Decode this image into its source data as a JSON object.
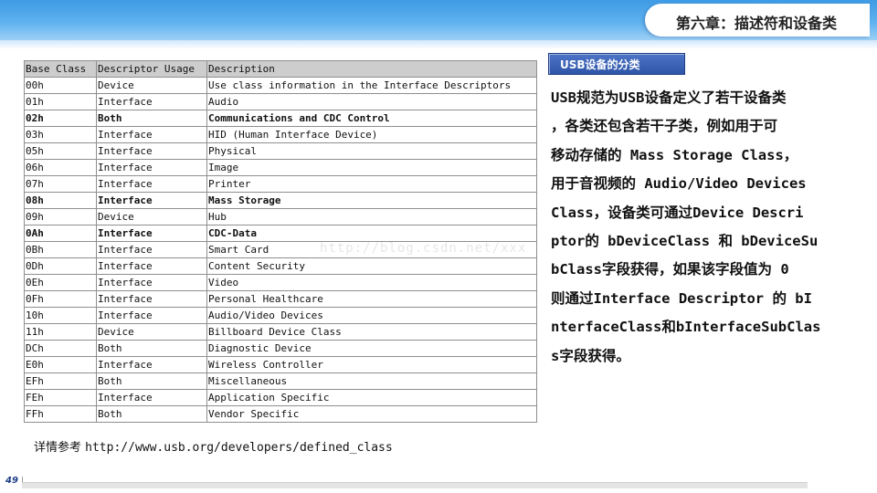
{
  "header": {
    "title": "第六章：描述符和设备类"
  },
  "table": {
    "columns": [
      "Base Class",
      "Descriptor Usage",
      "Description"
    ],
    "rows": [
      {
        "base": "00h",
        "usage": "Device",
        "desc": "Use class information in the Interface Descriptors",
        "bold": false
      },
      {
        "base": "01h",
        "usage": "Interface",
        "desc": "Audio",
        "bold": false
      },
      {
        "base": "02h",
        "usage": "Both",
        "desc": "Communications and CDC Control",
        "bold": true
      },
      {
        "base": "03h",
        "usage": "Interface",
        "desc": "HID (Human Interface Device)",
        "bold": false
      },
      {
        "base": "05h",
        "usage": "Interface",
        "desc": "Physical",
        "bold": false
      },
      {
        "base": "06h",
        "usage": "Interface",
        "desc": "Image",
        "bold": false
      },
      {
        "base": "07h",
        "usage": "Interface",
        "desc": "Printer",
        "bold": false
      },
      {
        "base": "08h",
        "usage": "Interface",
        "desc": "Mass Storage",
        "bold": true
      },
      {
        "base": "09h",
        "usage": "Device",
        "desc": "Hub",
        "bold": false
      },
      {
        "base": "0Ah",
        "usage": "Interface",
        "desc": "CDC-Data",
        "bold": true
      },
      {
        "base": "0Bh",
        "usage": "Interface",
        "desc": "Smart Card",
        "bold": false
      },
      {
        "base": "0Dh",
        "usage": "Interface",
        "desc": "Content Security",
        "bold": false
      },
      {
        "base": "0Eh",
        "usage": "Interface",
        "desc": "Video",
        "bold": false
      },
      {
        "base": "0Fh",
        "usage": "Interface",
        "desc": "Personal Healthcare",
        "bold": false
      },
      {
        "base": "10h",
        "usage": "Interface",
        "desc": "Audio/Video Devices",
        "bold": false
      },
      {
        "base": "11h",
        "usage": "Device",
        "desc": "Billboard Device Class",
        "bold": false
      },
      {
        "base": "DCh",
        "usage": "Both",
        "desc": "Diagnostic Device",
        "bold": false
      },
      {
        "base": "E0h",
        "usage": "Interface",
        "desc": "Wireless Controller",
        "bold": false
      },
      {
        "base": "EFh",
        "usage": "Both",
        "desc": "Miscellaneous",
        "bold": false
      },
      {
        "base": "FEh",
        "usage": "Interface",
        "desc": "Application Specific",
        "bold": false
      },
      {
        "base": "FFh",
        "usage": "Both",
        "desc": "Vendor Specific",
        "bold": false
      }
    ]
  },
  "reference": {
    "label": "详情参考",
    "url": "http://www.usb.org/developers/defined_class"
  },
  "section": {
    "badge": "USB设备的分类",
    "lines": [
      "USB规范为USB设备定义了若干设备类",
      "，各类还包含若干子类，例如用于可",
      "移动存储的 Mass Storage Class，",
      "用于音视频的 Audio/Video Devices",
      "Class，设备类可通过Device Descri",
      "ptor的 bDeviceClass 和 bDeviceSu",
      "bClass字段获得，如果该字段值为 0",
      "则通过Interface Descriptor 的 bI",
      "nterfaceClass和bInterfaceSubClas",
      "s字段获得。"
    ]
  },
  "watermark": "http://blog.csdn.net/xxx",
  "footer": {
    "page_number": "49"
  }
}
